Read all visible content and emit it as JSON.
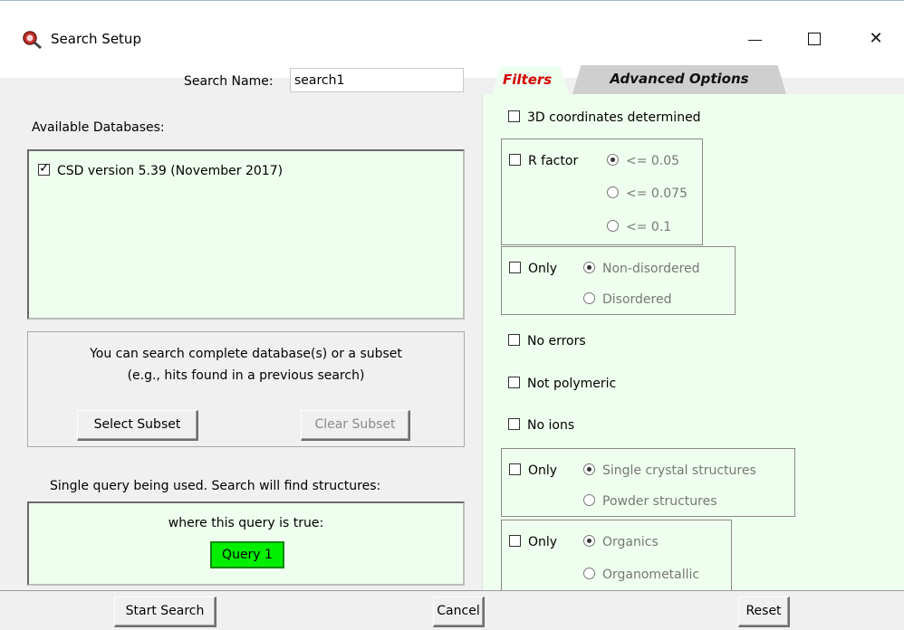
{
  "window": {
    "title": "Search Setup",
    "icon": "search-setup-icon",
    "controls": {
      "minimize_icon": "minimize-icon",
      "maximize_icon": "maximize-icon",
      "close_icon": "close-icon"
    }
  },
  "search": {
    "name_label": "Search Name:",
    "name_value": "search1"
  },
  "databases": {
    "label": "Available Databases:",
    "items": [
      {
        "label": "CSD version 5.39 (November 2017)",
        "checked": true
      }
    ]
  },
  "subset": {
    "line1": "You can search complete database(s) or a subset",
    "line2": "(e.g., hits found in a previous search)",
    "select_label": "Select Subset",
    "clear_label": "Clear Subset"
  },
  "query": {
    "label": "Single query being used. Search will find structures:",
    "condition": "where this query is true:",
    "badge": "Query 1",
    "badge_color": "#00f000"
  },
  "tabs": {
    "filters": "Filters",
    "advanced": "Advanced Options",
    "active_color": "#d40000"
  },
  "filters": {
    "coords": "3D coordinates determined",
    "rfactor": {
      "label": "R factor",
      "options": [
        "<= 0.05",
        "<= 0.075",
        "<= 0.1"
      ],
      "selected": 0
    },
    "disorder": {
      "label": "Only",
      "options": [
        "Non-disordered",
        "Disordered"
      ],
      "selected": 0
    },
    "no_errors": "No errors",
    "not_polymeric": "Not polymeric",
    "no_ions": "No ions",
    "crystal": {
      "label": "Only",
      "options": [
        "Single crystal structures",
        "Powder structures"
      ],
      "selected": 0
    },
    "organics": {
      "label": "Only",
      "options": [
        "Organics",
        "Organometallic"
      ],
      "selected": 0
    }
  },
  "footer": {
    "start": "Start Search",
    "cancel": "Cancel",
    "reset": "Reset"
  },
  "colors": {
    "panel_bg": "#efffef",
    "window_bg": "#f0f0f0"
  }
}
